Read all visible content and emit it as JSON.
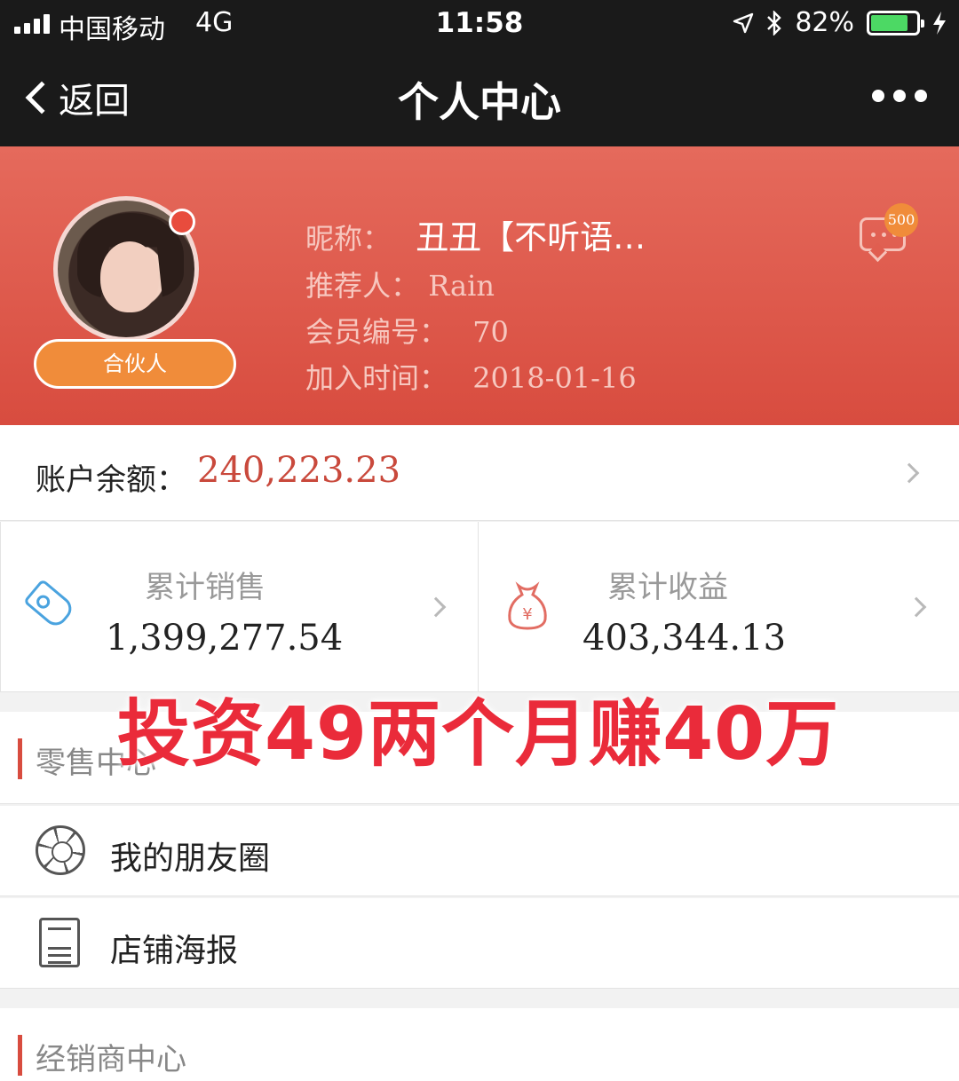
{
  "status_bar": {
    "carrier": "中国移动",
    "network": "4G",
    "time": "11:58",
    "battery": "82%",
    "battery_level": 0.82,
    "icons": [
      "signal-icon",
      "location-arrow-icon",
      "bluetooth-icon",
      "battery-icon",
      "charging-bolt-icon"
    ]
  },
  "nav": {
    "back_label": "返回",
    "title": "个人中心"
  },
  "profile": {
    "badge": "合伙人",
    "nickname_label": "昵称：",
    "nickname_value": "丑丑【不听语…",
    "referrer_label": "推荐人：",
    "referrer_value": "Rain",
    "member_no_label": "会员编号：",
    "member_no_value": "70",
    "join_label": "加入时间：",
    "join_value": "2018-01-16",
    "message_count": "500"
  },
  "balance": {
    "label": "账户余额：",
    "amount": "240,223.23"
  },
  "stats": [
    {
      "title": "累计销售",
      "value": "1,399,277.54",
      "icon": "price-tag-icon"
    },
    {
      "title": "累计收益",
      "value": "403,344.13",
      "icon": "money-bag-icon"
    }
  ],
  "overlay_text": "投资49两个月赚40万",
  "sections": {
    "retail": {
      "title": "零售中心",
      "items": [
        {
          "label": "我的朋友圈",
          "icon": "aperture-icon"
        },
        {
          "label": "店铺海报",
          "icon": "poster-icon"
        }
      ]
    },
    "dealer": {
      "title": "经销商中心"
    }
  },
  "colors": {
    "header_red": "#d84c3f",
    "accent_orange": "#f08c3a",
    "amount_red": "#c9493c",
    "overlay_red": "#ea2b3a",
    "tag_blue": "#4aa3df"
  }
}
